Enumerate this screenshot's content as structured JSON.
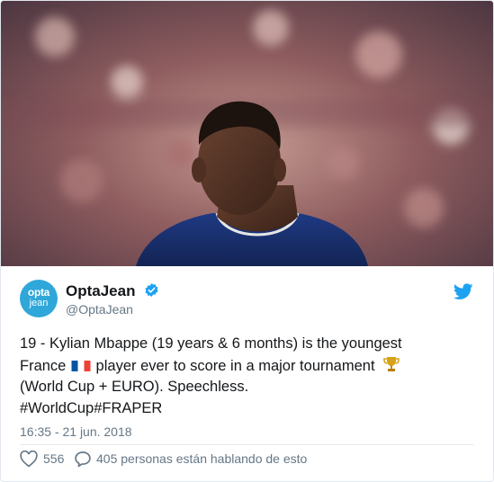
{
  "tweet": {
    "avatar_line1": "opta",
    "avatar_line2": "jean",
    "display_name": "OptaJean",
    "handle": "@OptaJean",
    "text_line1": "19 - Kylian Mbappe (19 years & 6 months) is the youngest",
    "text_line2_a": "France",
    "text_line2_b": "player ever to score in a major tournament",
    "text_line3": "(World Cup + EURO). Speechless.",
    "hashtags": "#WorldCup#FRAPER",
    "timestamp": "16:35 - 21 jun. 2018",
    "likes": "556",
    "conversation": "405 personas están hablando de esto"
  },
  "icons": {
    "verified": "verified-badge-icon",
    "twitter": "twitter-bird-icon",
    "flag": "france-flag-icon",
    "trophy": "trophy-icon",
    "like": "heart-icon",
    "reply": "speech-bubble-icon"
  },
  "colors": {
    "twitter_blue": "#1da1f2",
    "avatar_blue": "#2fa7d9",
    "text": "#14171a",
    "muted": "#657786"
  }
}
